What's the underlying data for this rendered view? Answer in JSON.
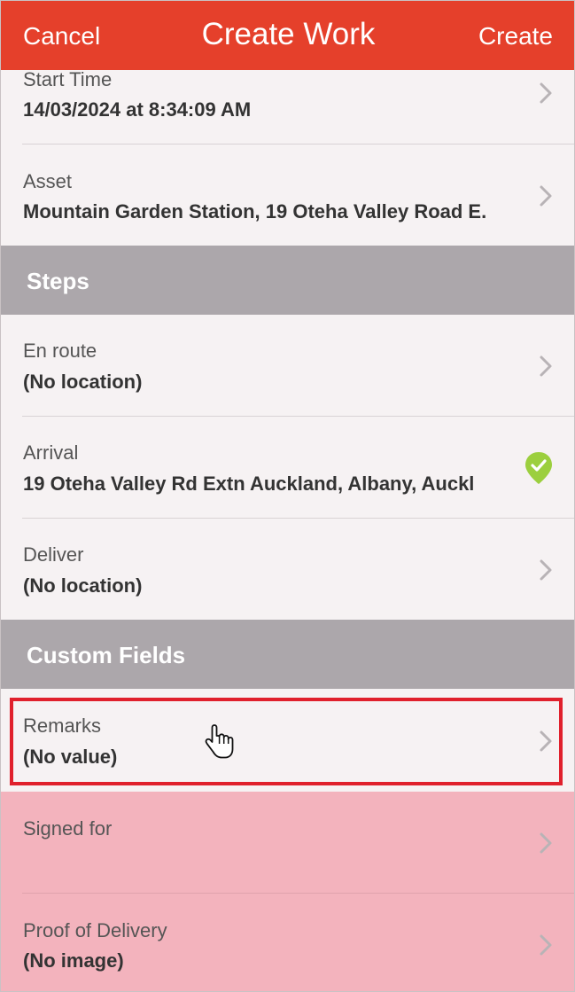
{
  "navbar": {
    "cancel_label": "Cancel",
    "title": "Create Work",
    "create_label": "Create",
    "color": "#e5402b"
  },
  "fields": {
    "start_time": {
      "label": "Start Time",
      "value": "14/03/2024 at 8:34:09 AM"
    },
    "asset": {
      "label": "Asset",
      "value": "Mountain Garden Station, 19 Oteha Valley Road E."
    }
  },
  "steps": {
    "section_title": "Steps",
    "en_route": {
      "label": "En route",
      "value": "(No location)"
    },
    "arrival": {
      "label": "Arrival",
      "value": "19 Oteha Valley Rd Extn Auckland, Albany, Auckl",
      "status_icon": "check-circle-icon",
      "status_color": "#9ccf3e"
    },
    "deliver": {
      "label": "Deliver",
      "value": "(No location)"
    }
  },
  "custom_fields": {
    "section_title": "Custom Fields",
    "remarks": {
      "label": "Remarks",
      "value": "(No value)"
    },
    "signed_for": {
      "label": "Signed for",
      "value": ""
    },
    "proof_of_delivery": {
      "label": "Proof of Delivery",
      "value": "(No image)"
    }
  },
  "icons": {
    "chevron": "chevron-right-icon",
    "cursor": "hand-pointer-icon"
  },
  "colors": {
    "section_bg": "#aca7ab",
    "highlight_border": "#e0202c",
    "highlight_fill": "#f3b3bd"
  }
}
